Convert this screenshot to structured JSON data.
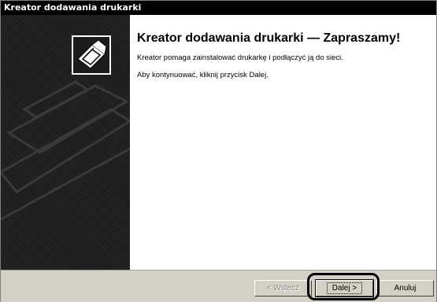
{
  "window": {
    "title": "Kreator dodawania drukarki"
  },
  "content": {
    "heading": "Kreator dodawania drukarki — Zapraszamy!",
    "description": "Kreator pomaga zainstalować drukarkę i podłączyć ją do sieci.",
    "instruction": "Aby kontynuować, kliknij przycisk Dalej."
  },
  "buttons": {
    "back": "< Wstecz",
    "next": "Dalej >",
    "cancel": "Anuluj"
  },
  "icons": {
    "wizard": "printer-wizard-icon",
    "background": "printer-silhouette-icon"
  }
}
